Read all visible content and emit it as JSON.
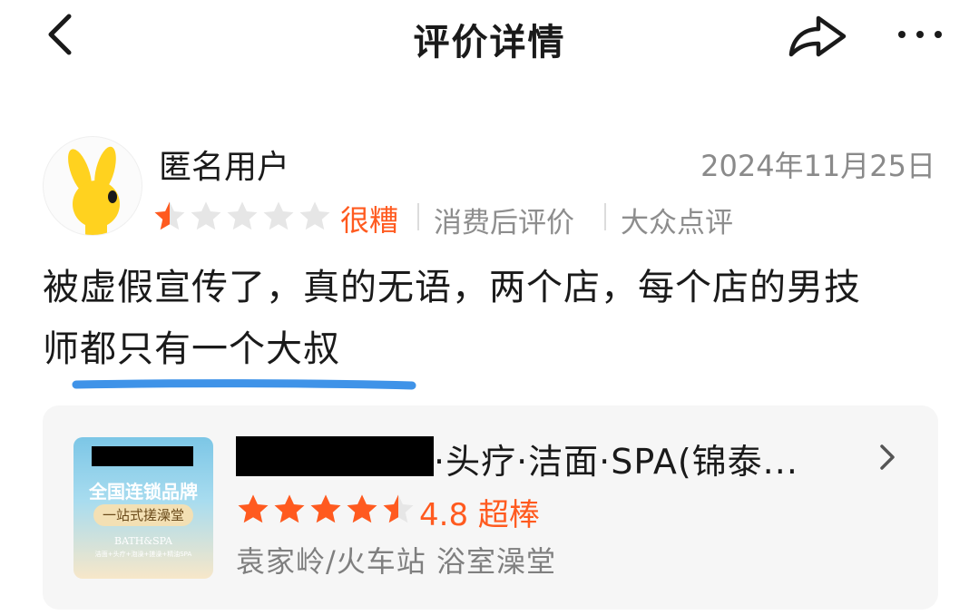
{
  "header": {
    "title": "评价详情",
    "back_icon": "chevron-left-icon",
    "share_icon": "share-arrow-icon",
    "more_icon": "more-dots-icon"
  },
  "review": {
    "username": "匿名用户",
    "date": "2024年11月25日",
    "star_rating": 0.5,
    "star_max": 5,
    "verdict": "很糟",
    "tags": [
      "消费后评价",
      "大众点评"
    ],
    "text_line1": "被虚假宣传了，真的无语，两个店，每个店的男技",
    "text_line2": "师都只有一个大叔"
  },
  "shop": {
    "image": {
      "line1": "全国连锁品牌",
      "line2": "一站式搓澡堂",
      "line3": "BATH&SPA",
      "line4": "洁面+头疗+泡澡+搓澡+精油SPA"
    },
    "name_visible": "·头疗·洁面·SPA(锦泰...",
    "star_rating": 4.5,
    "rating_text": "4.8 超棒",
    "location": "袁家岭/火车站 浴室澡堂"
  },
  "colors": {
    "accent": "#ff5a1f",
    "star_empty": "#e6e6e6",
    "secondary_text": "#8a8a8a",
    "card_bg": "#f6f6f6",
    "underline_blue": "#3f93e8"
  }
}
